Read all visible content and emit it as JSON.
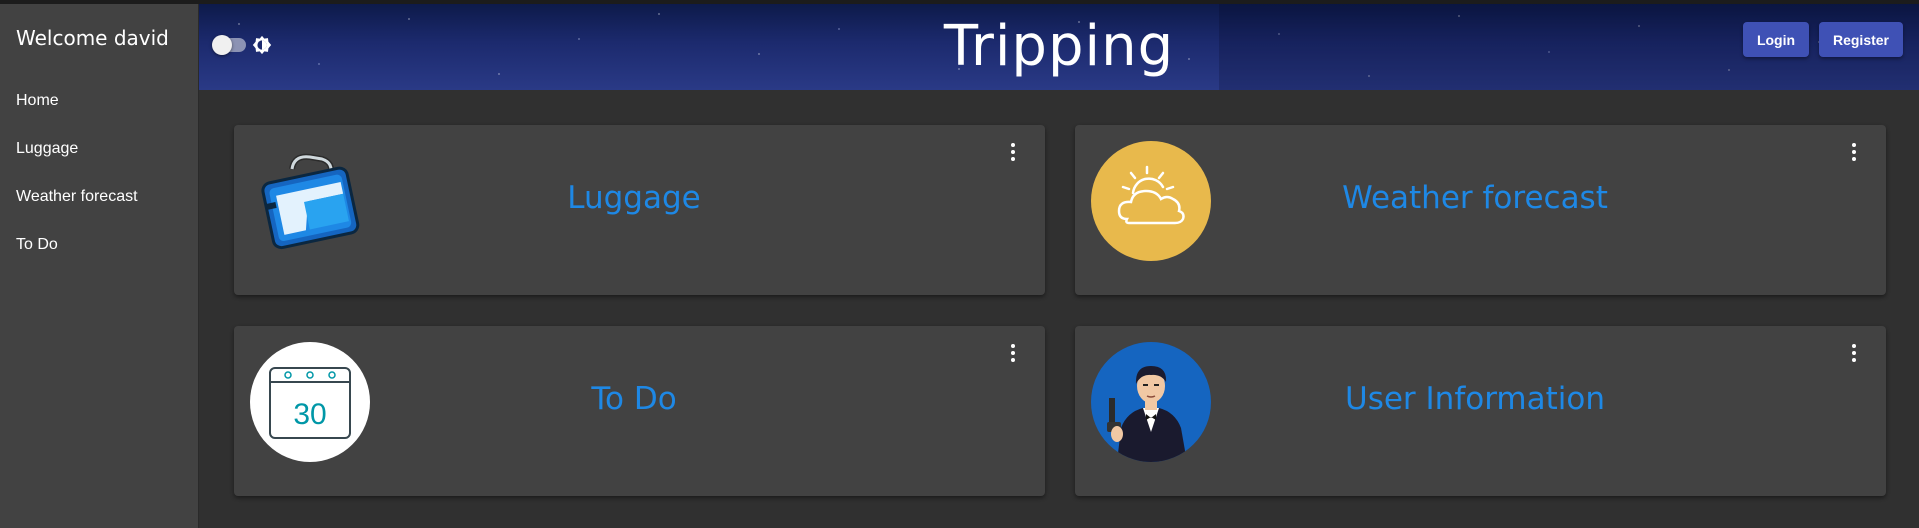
{
  "sidebar": {
    "welcome": "Welcome david",
    "items": [
      {
        "label": "Home"
      },
      {
        "label": "Luggage"
      },
      {
        "label": "Weather forecast"
      },
      {
        "label": "To Do"
      }
    ]
  },
  "header": {
    "title": "Tripping",
    "theme_toggle_icon": "toggle-switch-icon",
    "brightness_icon": "brightness-icon",
    "login_label": "Login",
    "register_label": "Register"
  },
  "cards": [
    {
      "label": "Luggage",
      "icon": "luggage-icon"
    },
    {
      "label": "Weather forecast",
      "icon": "weather-cloud-sun-icon"
    },
    {
      "label": "To Do",
      "icon": "calendar-icon",
      "calendar_day": "30"
    },
    {
      "label": "User Information",
      "icon": "agent-avatar-icon"
    }
  ],
  "colors": {
    "background": "#303030",
    "surface": "#424242",
    "accent": "#3f51b5",
    "card_label": "#1e88e5",
    "weather_circle": "#e8b94c",
    "user_circle": "#1565c0"
  }
}
